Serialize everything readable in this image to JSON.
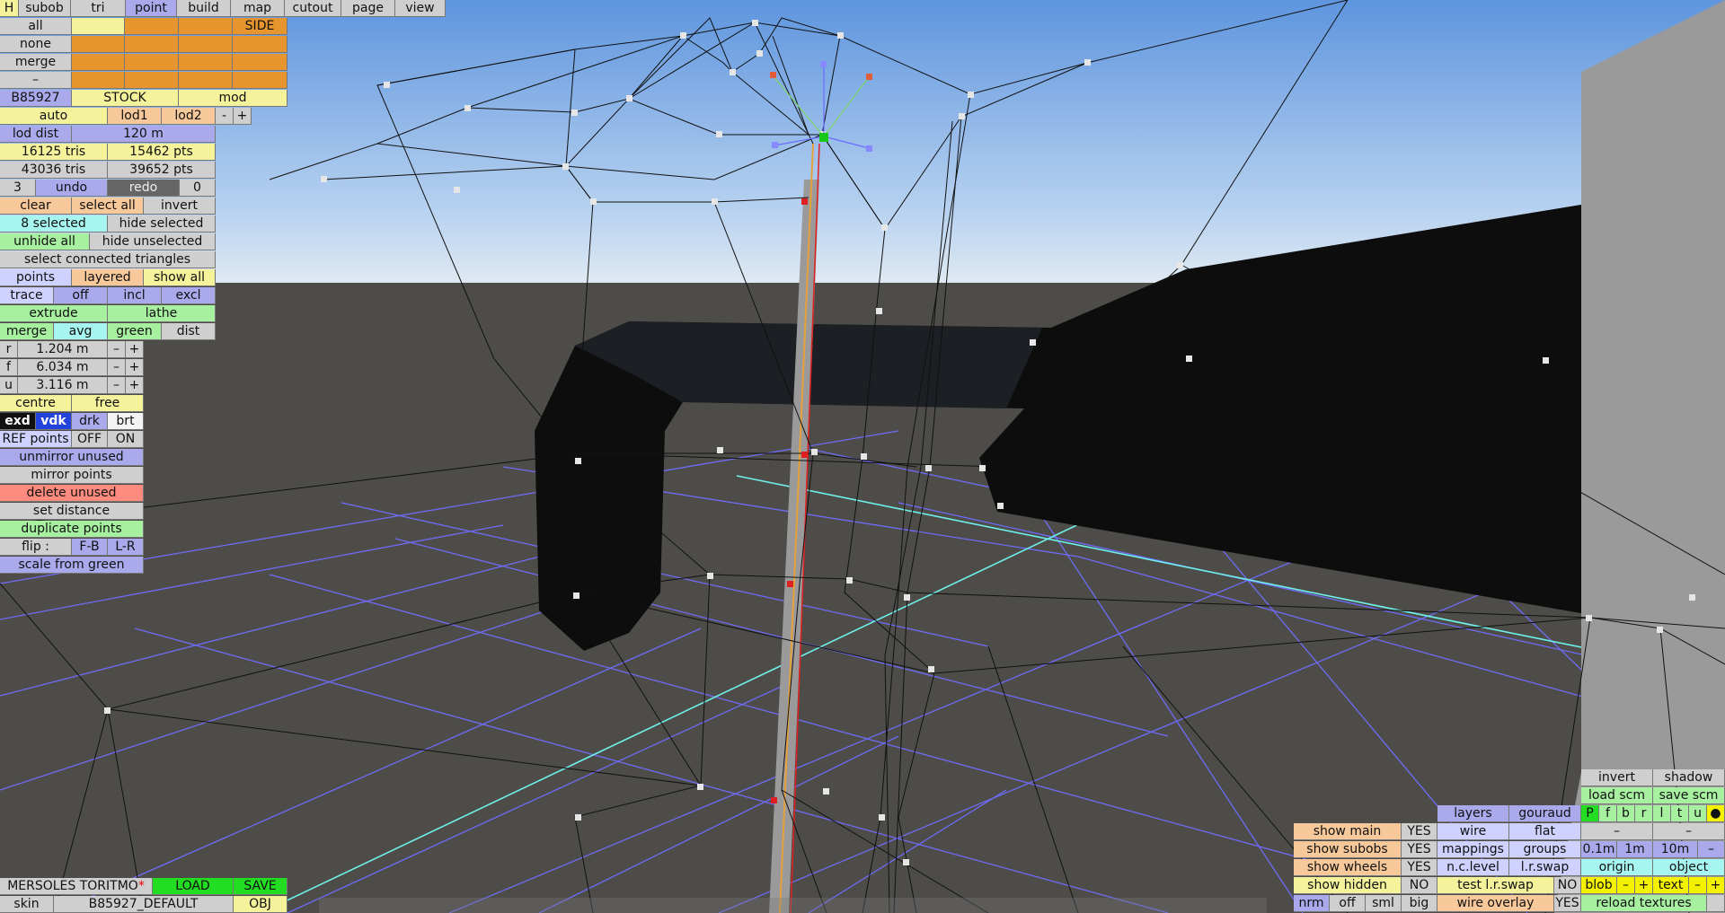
{
  "menu": [
    "H",
    "subob",
    "tri",
    "point",
    "build",
    "map",
    "cutout",
    "page",
    "view"
  ],
  "select_rows": {
    "all": "all",
    "none": "none",
    "merge": "merge",
    "dash": "–",
    "side": "SIDE"
  },
  "model": {
    "code": "B85927",
    "stock": "STOCK",
    "mod": "mod"
  },
  "lod": {
    "auto": "auto",
    "lod1": "lod1",
    "lod2": "lod2",
    "minus": "-",
    "plus": "+",
    "dist_label": "lod dist",
    "dist_value": "120 m"
  },
  "counts": {
    "tris1": "16125 tris",
    "pts1": "15462 pts",
    "tris2": "43036 tris",
    "pts2": "39652 pts"
  },
  "undo": {
    "undo_count": "3",
    "undo": "undo",
    "redo": "redo",
    "redo_count": "0"
  },
  "selection": {
    "clear": "clear",
    "select_all": "select all",
    "invert": "invert",
    "selected": "8 selected",
    "hide_selected": "hide selected",
    "unhide_all": "unhide all",
    "hide_unselected": "hide unselected",
    "connected": "select connected triangles"
  },
  "points_row": {
    "points": "points",
    "layered": "layered",
    "show_all": "show all"
  },
  "trace_row": {
    "trace": "trace",
    "off": "off",
    "incl": "incl",
    "excl": "excl"
  },
  "extrude_row": {
    "extrude": "extrude",
    "lathe": "lathe"
  },
  "merge_row": {
    "merge": "merge",
    "avg": "avg",
    "green": "green",
    "dist": "dist"
  },
  "coords": [
    {
      "label": "r",
      "value": "1.204 m"
    },
    {
      "label": "f",
      "value": "6.034 m"
    },
    {
      "label": "u",
      "value": "3.116 m"
    }
  ],
  "centre_row": {
    "centre": "centre",
    "free": "free"
  },
  "shade_row": {
    "exd": "exd",
    "vdk": "vdk",
    "drk": "drk",
    "brt": "brt"
  },
  "ref_row": {
    "ref": "REF points",
    "off": "OFF",
    "on": "ON"
  },
  "tools": {
    "unmirror": "unmirror unused",
    "mirror": "mirror points",
    "delete": "delete unused",
    "set_distance": "set distance",
    "duplicate": "duplicate points",
    "flip": "flip :",
    "fb": "F-B",
    "lr": "L-R",
    "scale": "scale from green"
  },
  "bottom_left": {
    "name": "MERSOLES TORITMO",
    "star": "*",
    "load": "LOAD",
    "save": "SAVE",
    "skin": "skin",
    "skin_value": "B85927_DEFAULT",
    "obj": "OBJ"
  },
  "right_panel": {
    "invert": "invert",
    "shadow": "shadow",
    "load_scm": "load scm",
    "save_scm": "save scm",
    "layers": "layers",
    "gouraud": "gouraud",
    "pflags": [
      "P",
      "f",
      "b",
      "r",
      "l",
      "t",
      "u",
      "●"
    ],
    "wire": "wire",
    "flat": "flat",
    "dash1": "–",
    "dash2": "–",
    "mappings": "mappings",
    "groups": "groups",
    "g01": "0.1m",
    "g1": "1m",
    "g10": "10m",
    "gminus": "–",
    "nclevel": "n.c.level",
    "lrswap": "l.r.swap",
    "origin": "origin",
    "object": "object",
    "test_lrswap": "test l.r.swap",
    "test_no": "NO",
    "blob": "blob",
    "text": "text",
    "wire_overlay": "wire overlay",
    "wire_overlay_yes": "YES",
    "reload": "reload textures",
    "nrm": "nrm",
    "off": "off",
    "sml": "sml",
    "big": "big"
  },
  "show_panel": [
    {
      "label": "show main",
      "value": "YES"
    },
    {
      "label": "show subobs",
      "value": "YES"
    },
    {
      "label": "show wheels",
      "value": "YES"
    },
    {
      "label": "show hidden",
      "value": "NO"
    }
  ]
}
